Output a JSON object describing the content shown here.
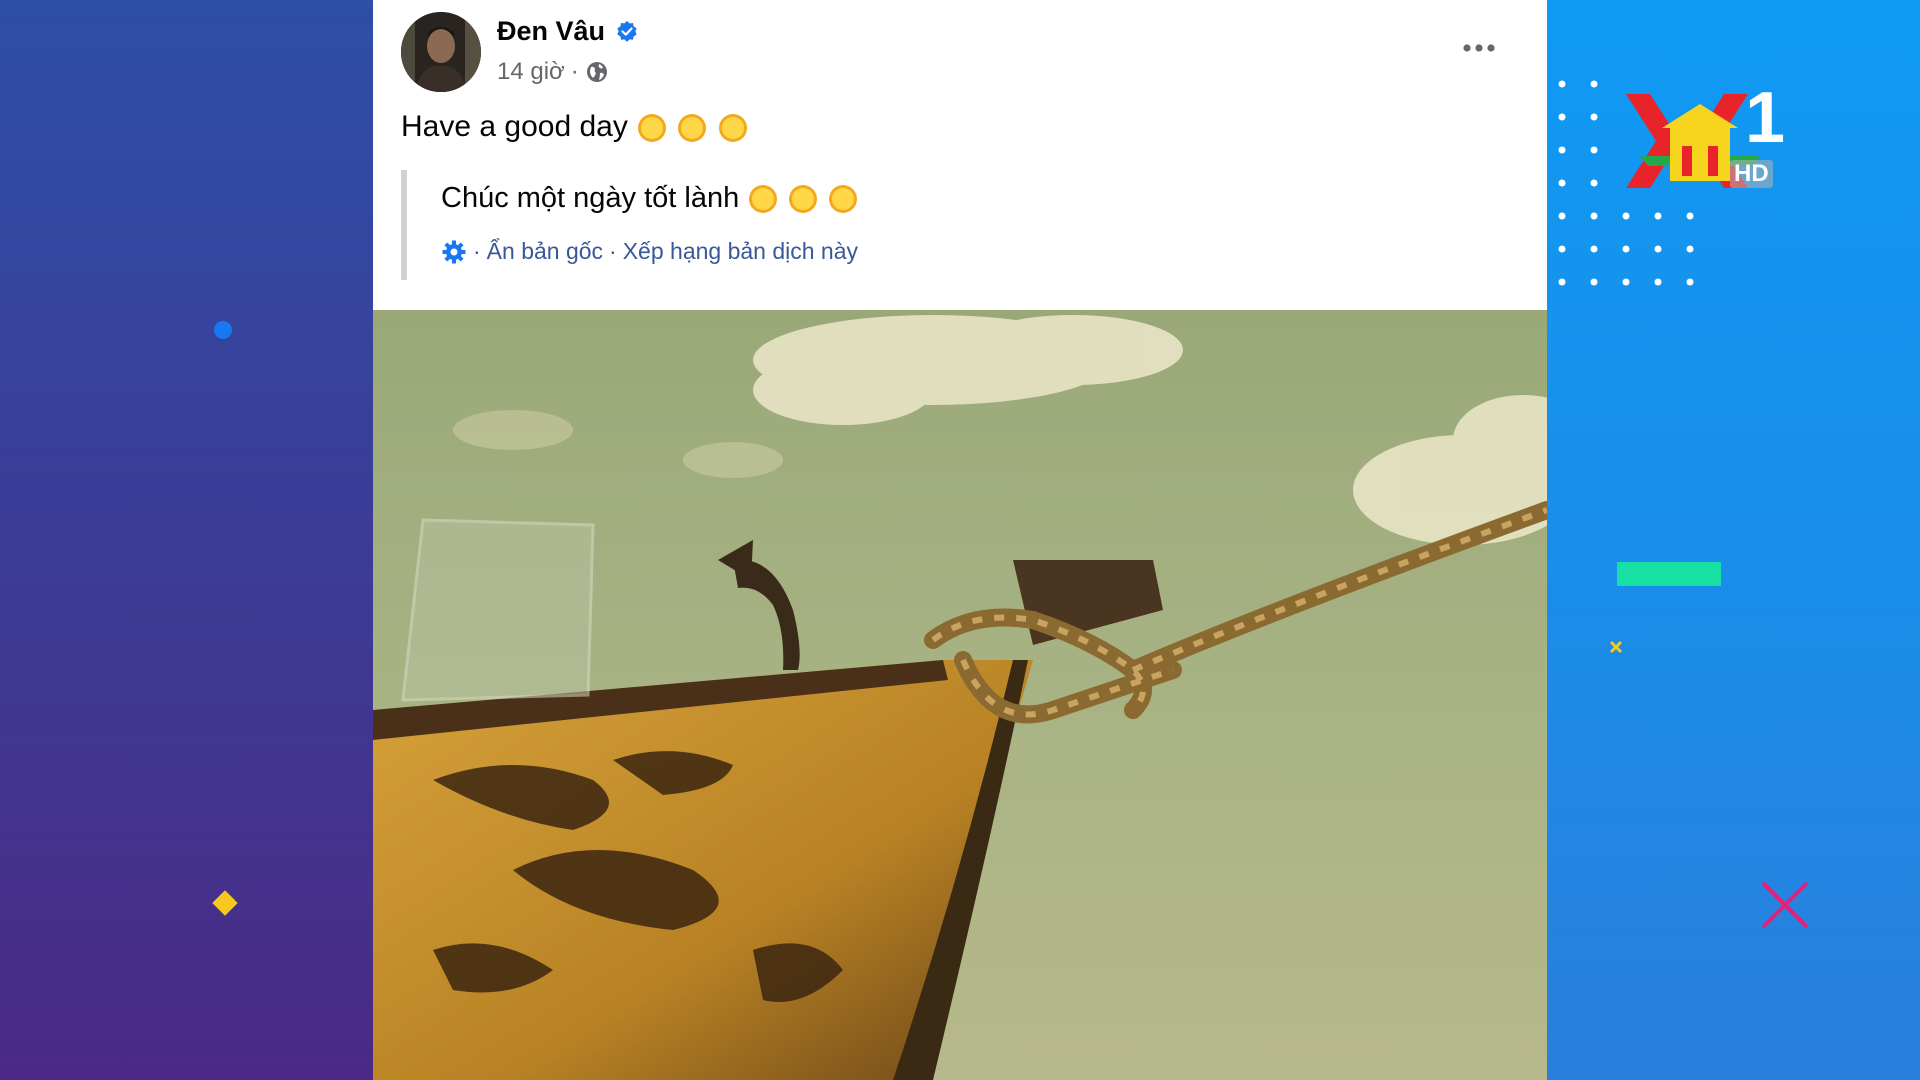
{
  "post": {
    "author_name": "Đen Vâu",
    "timestamp": "14 giờ",
    "meta_separator": "·",
    "text": "Have a good day",
    "translation": {
      "text": "Chúc một ngày tốt lành",
      "hide_original_label": "Ẩn bản gốc",
      "rate_translation_label": "Xếp hạng bản dịch này",
      "separator": "·"
    },
    "emoji_count": 3,
    "image_alt": "Wooden boat bow tied with rope under a cloudy sky"
  },
  "channel_logo": {
    "number": "1",
    "hd_label": "HD"
  },
  "colors": {
    "link": "#385898",
    "verified": "#1877f2",
    "left_background": "#3a3e98",
    "right_background": "#1a8de8",
    "accent_green": "#17e0a4",
    "accent_yellow": "#f7c81e",
    "accent_pink": "#e3207a"
  },
  "icons": [
    "verified-badge-icon",
    "globe-icon",
    "more-options-icon",
    "gear-icon",
    "sun-emoji-icon",
    "channel-logo"
  ]
}
